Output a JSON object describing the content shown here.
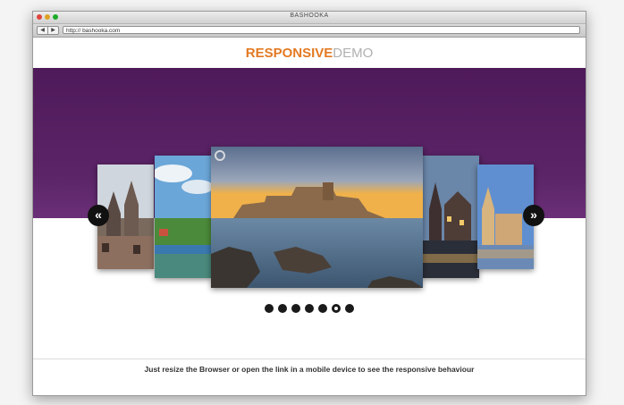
{
  "window": {
    "title": "BASHOOKA"
  },
  "toolbar": {
    "back_label": "◀",
    "forward_label": "▶",
    "url": "http:// bashooka.com"
  },
  "header": {
    "logo_accent": "RESPONSIVE",
    "logo_rest": "DEMO"
  },
  "slider": {
    "prev_label": "«",
    "next_label": "»",
    "dots": [
      {
        "active": false
      },
      {
        "active": false
      },
      {
        "active": false
      },
      {
        "active": false
      },
      {
        "active": false
      },
      {
        "active": true
      },
      {
        "active": false
      }
    ]
  },
  "footer": {
    "text": "Just resize the Browser or open the link in a mobile device to see the responsive behaviour"
  },
  "colors": {
    "accent": "#e37a22",
    "hero": "#4f1a5a",
    "muted": "#b0b0b0"
  }
}
